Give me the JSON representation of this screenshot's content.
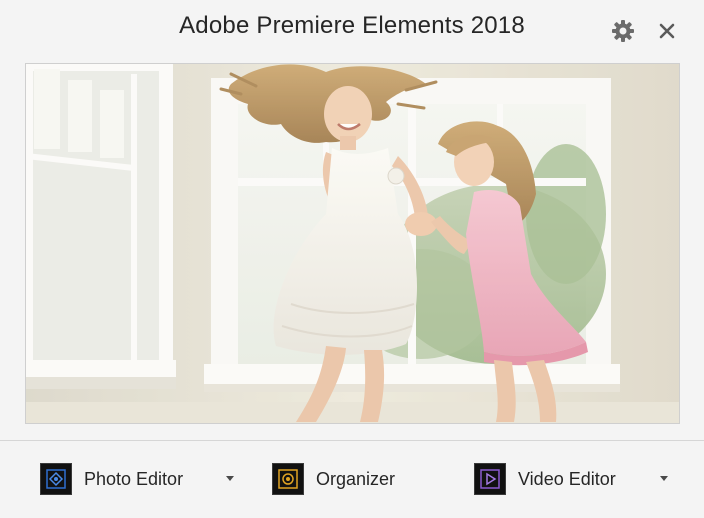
{
  "window": {
    "title": "Adobe Premiere Elements 2018"
  },
  "header": {
    "settings_icon": "gear-icon",
    "close_icon": "close-icon"
  },
  "hero": {
    "subject": "Two girls dancing in front of a bright window"
  },
  "launchers": [
    {
      "label": "Photo Editor",
      "icon": "photo-editor-icon",
      "accent": "#2f6fd0",
      "has_dropdown": true
    },
    {
      "label": "Organizer",
      "icon": "organizer-icon",
      "accent": "#e0a323",
      "has_dropdown": false
    },
    {
      "label": "Video Editor",
      "icon": "video-editor-icon",
      "accent": "#8a5bd0",
      "has_dropdown": true
    }
  ],
  "colors": {
    "background": "#f4f4f4",
    "text": "#262626",
    "icon_gray": "#6b6b6b"
  }
}
